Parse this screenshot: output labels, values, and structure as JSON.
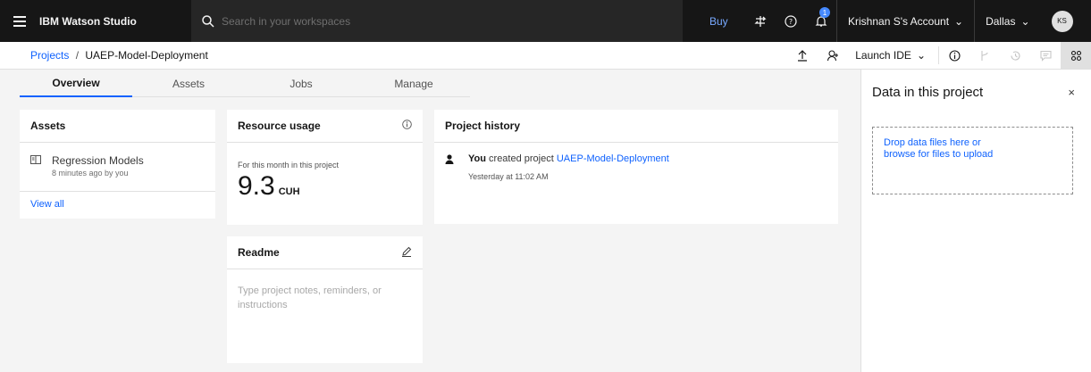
{
  "header": {
    "brand": "IBM Watson Studio",
    "search_placeholder": "Search in your workspaces",
    "buy_label": "Buy",
    "notification_count": "1",
    "account_label": "Krishnan S's Account",
    "region_label": "Dallas",
    "avatar_initials": "KS"
  },
  "breadcrumb": {
    "projects": "Projects",
    "separator": "/",
    "current": "UAEP-Model-Deployment"
  },
  "toolbar": {
    "launch_label": "Launch IDE"
  },
  "tabs": [
    {
      "label": "Overview"
    },
    {
      "label": "Assets"
    },
    {
      "label": "Jobs"
    },
    {
      "label": "Manage"
    }
  ],
  "assets_card": {
    "title": "Assets",
    "items": [
      {
        "name": "Regression Models",
        "meta": "8 minutes ago by you"
      }
    ],
    "view_all": "View all"
  },
  "resource_card": {
    "title": "Resource usage",
    "period": "For this month in this project",
    "value": "9.3",
    "unit": "CUH"
  },
  "readme_card": {
    "title": "Readme",
    "placeholder": "Type project notes, reminders, or instructions"
  },
  "history_card": {
    "title": "Project history",
    "entries": [
      {
        "actor": "You",
        "action": "created project",
        "target": "UAEP-Model-Deployment",
        "time": "Yesterday at 11:02 AM"
      }
    ]
  },
  "data_panel": {
    "title": "Data in this project",
    "close": "×",
    "drop_line1": "Drop data files here or",
    "drop_line2": "browse for files to upload"
  },
  "colors": {
    "header_bg": "#161616",
    "accent": "#0f62fe",
    "page_bg": "#f4f4f4"
  }
}
